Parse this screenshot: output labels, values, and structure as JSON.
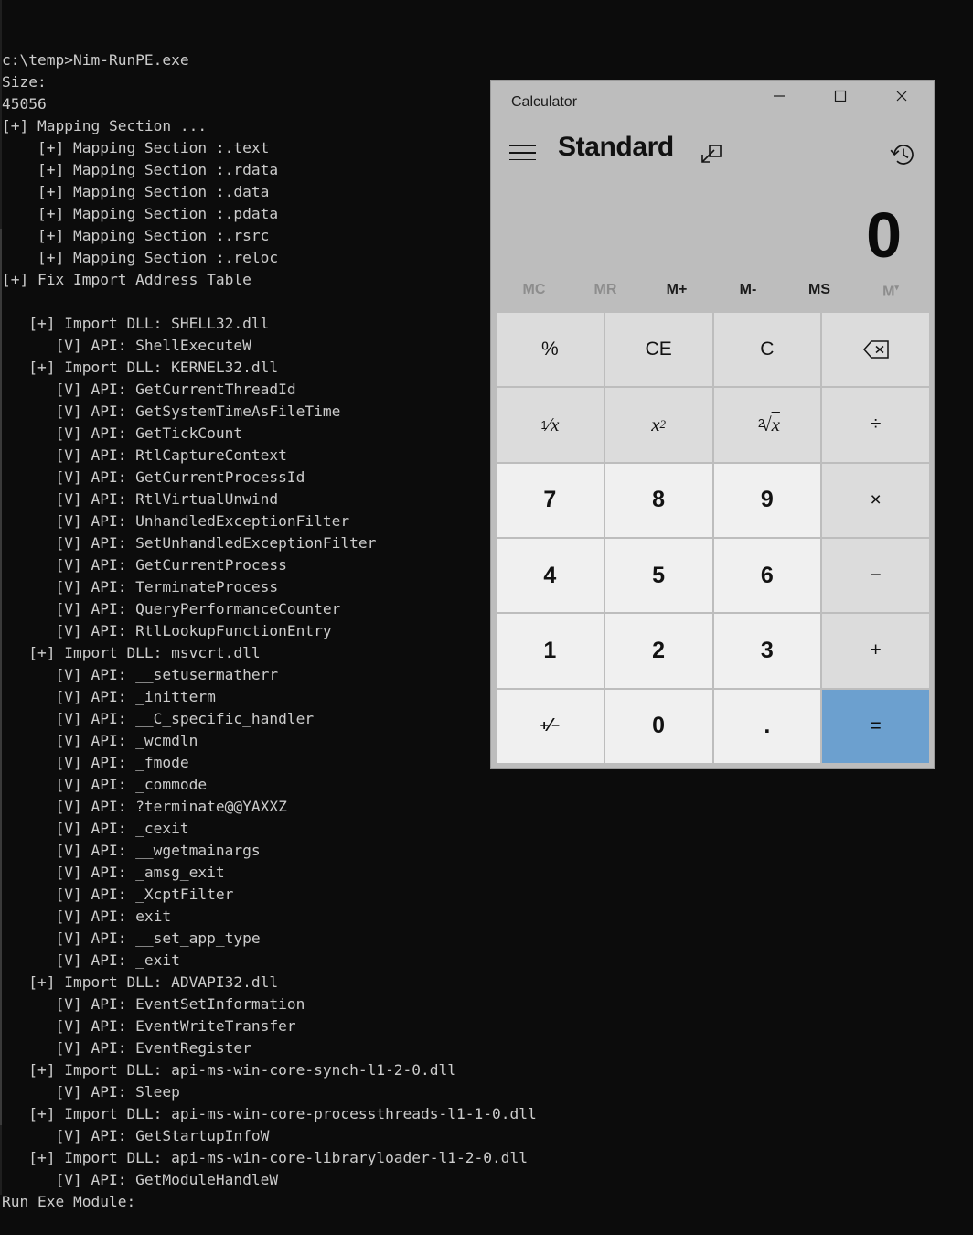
{
  "terminal": {
    "lines": [
      "c:\\temp>Nim-RunPE.exe",
      "Size:",
      "45056",
      "[+] Mapping Section ...",
      "    [+] Mapping Section :.text",
      "    [+] Mapping Section :.rdata",
      "    [+] Mapping Section :.data",
      "    [+] Mapping Section :.pdata",
      "    [+] Mapping Section :.rsrc",
      "    [+] Mapping Section :.reloc",
      "[+] Fix Import Address Table",
      "",
      "   [+] Import DLL: SHELL32.dll",
      "      [V] API: ShellExecuteW",
      "   [+] Import DLL: KERNEL32.dll",
      "      [V] API: GetCurrentThreadId",
      "      [V] API: GetSystemTimeAsFileTime",
      "      [V] API: GetTickCount",
      "      [V] API: RtlCaptureContext",
      "      [V] API: GetCurrentProcessId",
      "      [V] API: RtlVirtualUnwind",
      "      [V] API: UnhandledExceptionFilter",
      "      [V] API: SetUnhandledExceptionFilter",
      "      [V] API: GetCurrentProcess",
      "      [V] API: TerminateProcess",
      "      [V] API: QueryPerformanceCounter",
      "      [V] API: RtlLookupFunctionEntry",
      "   [+] Import DLL: msvcrt.dll",
      "      [V] API: __setusermatherr",
      "      [V] API: _initterm",
      "      [V] API: __C_specific_handler",
      "      [V] API: _wcmdln",
      "      [V] API: _fmode",
      "      [V] API: _commode",
      "      [V] API: ?terminate@@YAXXZ",
      "      [V] API: _cexit",
      "      [V] API: __wgetmainargs",
      "      [V] API: _amsg_exit",
      "      [V] API: _XcptFilter",
      "      [V] API: exit",
      "      [V] API: __set_app_type",
      "      [V] API: _exit",
      "   [+] Import DLL: ADVAPI32.dll",
      "      [V] API: EventSetInformation",
      "      [V] API: EventWriteTransfer",
      "      [V] API: EventRegister",
      "   [+] Import DLL: api-ms-win-core-synch-l1-2-0.dll",
      "      [V] API: Sleep",
      "   [+] Import DLL: api-ms-win-core-processthreads-l1-1-0.dll",
      "      [V] API: GetStartupInfoW",
      "   [+] Import DLL: api-ms-win-core-libraryloader-l1-2-0.dll",
      "      [V] API: GetModuleHandleW",
      "Run Exe Module:"
    ]
  },
  "calculator": {
    "window_title": "Calculator",
    "window_controls": {
      "minimize": "minimize-icon",
      "maximize": "maximize-icon",
      "close": "close-icon"
    },
    "menu_icon": "hamburger-icon",
    "mode_title": "Standard",
    "keep_on_top_icon": "keep-on-top-icon",
    "history_icon": "history-icon",
    "display_value": "0",
    "memory": [
      {
        "label": "MC",
        "enabled": false
      },
      {
        "label": "MR",
        "enabled": false
      },
      {
        "label": "M+",
        "enabled": true
      },
      {
        "label": "M-",
        "enabled": true
      },
      {
        "label": "MS",
        "enabled": true
      },
      {
        "label": "M",
        "enabled": false,
        "dropdown": true
      }
    ],
    "keys": [
      {
        "label": "%",
        "kind": "op",
        "name": "percent"
      },
      {
        "label": "CE",
        "kind": "op",
        "name": "clear-entry"
      },
      {
        "label": "C",
        "kind": "op",
        "name": "clear"
      },
      {
        "label": "⌫",
        "kind": "op",
        "name": "backspace"
      },
      {
        "label": "1/x",
        "kind": "op",
        "name": "reciprocal"
      },
      {
        "label": "x2",
        "kind": "op",
        "name": "square"
      },
      {
        "label": "2√x",
        "kind": "op",
        "name": "square-root"
      },
      {
        "label": "÷",
        "kind": "op",
        "name": "divide"
      },
      {
        "label": "7",
        "kind": "num",
        "name": "seven"
      },
      {
        "label": "8",
        "kind": "num",
        "name": "eight"
      },
      {
        "label": "9",
        "kind": "num",
        "name": "nine"
      },
      {
        "label": "×",
        "kind": "op",
        "name": "multiply"
      },
      {
        "label": "4",
        "kind": "num",
        "name": "four"
      },
      {
        "label": "5",
        "kind": "num",
        "name": "five"
      },
      {
        "label": "6",
        "kind": "num",
        "name": "six"
      },
      {
        "label": "−",
        "kind": "op",
        "name": "subtract"
      },
      {
        "label": "1",
        "kind": "num",
        "name": "one"
      },
      {
        "label": "2",
        "kind": "num",
        "name": "two"
      },
      {
        "label": "3",
        "kind": "num",
        "name": "three"
      },
      {
        "label": "+",
        "kind": "op",
        "name": "add"
      },
      {
        "label": "+/−",
        "kind": "num",
        "name": "negate"
      },
      {
        "label": "0",
        "kind": "num",
        "name": "zero"
      },
      {
        "label": ".",
        "kind": "num",
        "name": "decimal"
      },
      {
        "label": "=",
        "kind": "equals",
        "name": "equals"
      }
    ],
    "colors": {
      "window_bg": "#bdbdbd",
      "number_key": "#f0f0f0",
      "operator_key": "#dcdcdc",
      "equals_key": "#6ca0cf"
    }
  }
}
